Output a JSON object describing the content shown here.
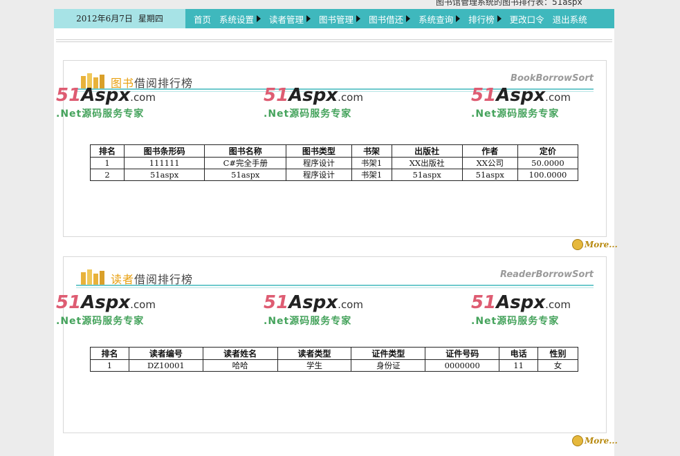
{
  "window_title_partial": "图书馆管理系统的图书排行表：51aspx",
  "header": {
    "date": "2012年6月7日",
    "weekday": "星期四",
    "nav": [
      {
        "label": "首页",
        "has_submenu": false
      },
      {
        "label": "系统设置",
        "has_submenu": true
      },
      {
        "label": "读者管理",
        "has_submenu": true
      },
      {
        "label": "图书管理",
        "has_submenu": true
      },
      {
        "label": "图书借还",
        "has_submenu": true
      },
      {
        "label": "系统查询",
        "has_submenu": true
      },
      {
        "label": "排行榜",
        "has_submenu": true
      },
      {
        "label": "更改口令",
        "has_submenu": false
      },
      {
        "label": "退出系统",
        "has_submenu": false
      }
    ]
  },
  "watermark": {
    "num": "51",
    "aspx": "Aspx",
    "com": ".com",
    "tagline": ".Net源码服务专家"
  },
  "book_panel": {
    "title_highlight": "图书",
    "title_rest": "借阅排行榜",
    "title_en": "BookBorrowSort",
    "more_label": "More...",
    "columns": [
      "排名",
      "图书条形码",
      "图书名称",
      "图书类型",
      "书架",
      "出版社",
      "作者",
      "定价"
    ],
    "rows": [
      [
        "1",
        "111111",
        "C#完全手册",
        "程序设计",
        "书架1",
        "XX出版社",
        "XX公司",
        "50.0000"
      ],
      [
        "2",
        "51aspx",
        "51aspx",
        "程序设计",
        "书架1",
        "51aspx",
        "51aspx",
        "100.0000"
      ]
    ]
  },
  "reader_panel": {
    "title_highlight": "读者",
    "title_rest": "借阅排行榜",
    "title_en": "ReaderBorrowSort",
    "more_label": "More...",
    "columns": [
      "排名",
      "读者编号",
      "读者姓名",
      "读者类型",
      "证件类型",
      "证件号码",
      "电话",
      "性别"
    ],
    "rows": [
      [
        "1",
        "DZ10001",
        "哈哈",
        "学生",
        "身份证",
        "0000000",
        "11",
        "女"
      ]
    ]
  },
  "colors": {
    "nav_bg": "#3fb8bd",
    "date_bg": "#a7e3e6",
    "watermark_red": "#de5c72",
    "watermark_green": "#45a35c",
    "title_highlight": "#e8a010"
  }
}
